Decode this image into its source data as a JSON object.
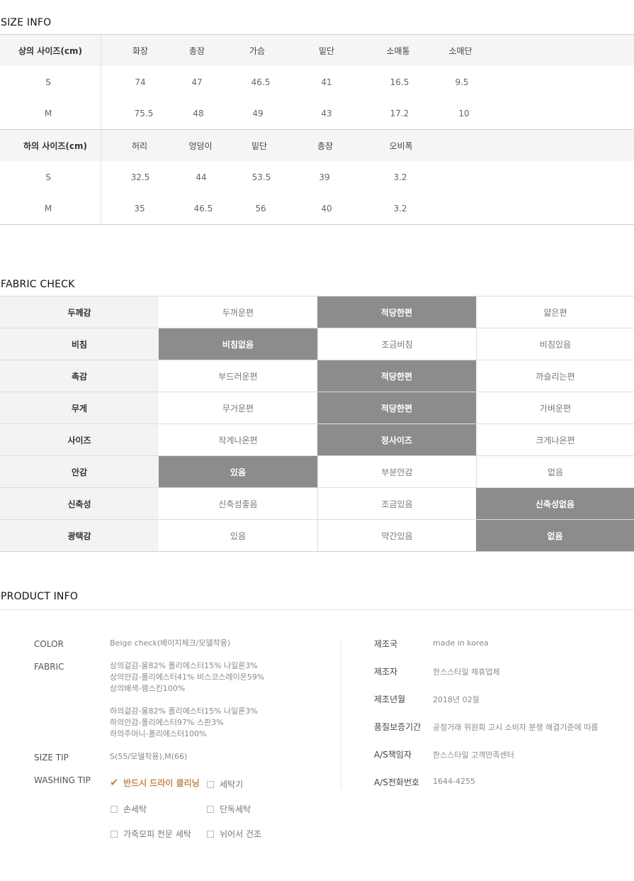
{
  "size_info": {
    "title": "SIZE INFO",
    "top": {
      "label": "상의 사이즈(cm)",
      "columns": [
        "화장",
        "총장",
        "가슴",
        "밑단",
        "소매통",
        "소매단"
      ],
      "rows": [
        {
          "size": "S",
          "values": [
            "74",
            "47",
            "46.5",
            "41",
            "16.5",
            "9.5"
          ]
        },
        {
          "size": "M",
          "values": [
            "75.5",
            "48",
            "49",
            "43",
            "17.2",
            "10"
          ]
        }
      ]
    },
    "bottom": {
      "label": "하의 사이즈(cm)",
      "columns": [
        "허리",
        "엉덩이",
        "밑단",
        "총장",
        "오비폭"
      ],
      "rows": [
        {
          "size": "S",
          "values": [
            "32.5",
            "44",
            "53.5",
            "39",
            "3.2"
          ]
        },
        {
          "size": "M",
          "values": [
            "35",
            "46.5",
            "56",
            "40",
            "3.2"
          ]
        }
      ]
    }
  },
  "fabric_check": {
    "title": "FABRIC CHECK",
    "rows": [
      {
        "label": "두께감",
        "options": [
          "두꺼운편",
          "적당한편",
          "얇은편"
        ],
        "selected": 1
      },
      {
        "label": "비침",
        "options": [
          "비침없음",
          "조금비침",
          "비침있음"
        ],
        "selected": 0
      },
      {
        "label": "촉감",
        "options": [
          "부드러운편",
          "적당한편",
          "까슬리는편"
        ],
        "selected": 1
      },
      {
        "label": "무게",
        "options": [
          "무거운편",
          "적당한편",
          "가벼운편"
        ],
        "selected": 1
      },
      {
        "label": "사이즈",
        "options": [
          "작게나온편",
          "정사이즈",
          "크게나온편"
        ],
        "selected": 1
      },
      {
        "label": "안감",
        "options": [
          "있음",
          "부분안감",
          "없음"
        ],
        "selected": 0
      },
      {
        "label": "신축성",
        "options": [
          "신축성좋음",
          "조금있음",
          "신축성없음"
        ],
        "selected": 2
      },
      {
        "label": "광택감",
        "options": [
          "있음",
          "약간있음",
          "없음"
        ],
        "selected": 2
      }
    ]
  },
  "product_info": {
    "title": "PRODUCT INFO",
    "color_label": "COLOR",
    "color_value": "Beige check(베이지체크/모델착용)",
    "fabric_label": "FABRIC",
    "fabric_lines_top": [
      "상의겉감-울82% 폴리에스터15% 나일론3%",
      "상의안감-폴리에스터41% 비스코스레이온59%",
      "상의배색-램스킨100%"
    ],
    "fabric_lines_bottom": [
      "하의겉감-울82% 폴리에스터15% 나일론3%",
      "하의안감-폴리에스터97% 스판3%",
      "하의주머니-폴리에스터100%"
    ],
    "size_tip_label": "SIZE TIP",
    "size_tip_value": "S(55/모델착용),M(66)",
    "washing_tip_label": "WASHING TIP",
    "washing_options": [
      {
        "label": "반드시 드라이 클리닝",
        "checked": true
      },
      {
        "label": "세탁기",
        "checked": false
      },
      {
        "label": "손세탁",
        "checked": false
      },
      {
        "label": "단독세탁",
        "checked": false
      },
      {
        "label": "가죽모피 전문 세탁",
        "checked": false
      },
      {
        "label": "뉘어서 건조",
        "checked": false
      }
    ],
    "right": [
      {
        "label": "제조국",
        "value": "made in korea"
      },
      {
        "label": "제조자",
        "value": "한스스타일 제휴업체"
      },
      {
        "label": "제조년월",
        "value": "2018년 02월"
      },
      {
        "label": "품질보증기간",
        "value": "공정거래 위원회 고시 소비자 분쟁 해결기준에 따름"
      },
      {
        "label": "A/S책임자",
        "value": "한스스타일 고객만족센터"
      },
      {
        "label": "A/S전화번호",
        "value": "1644-4255"
      }
    ]
  },
  "colors": {
    "selected_bg": "#8c8c8c",
    "label_bg": "#f3f3f3",
    "accent": "#c08a52"
  },
  "icons": {
    "checked": "check-mark-icon",
    "unchecked": "checkbox-icon"
  }
}
